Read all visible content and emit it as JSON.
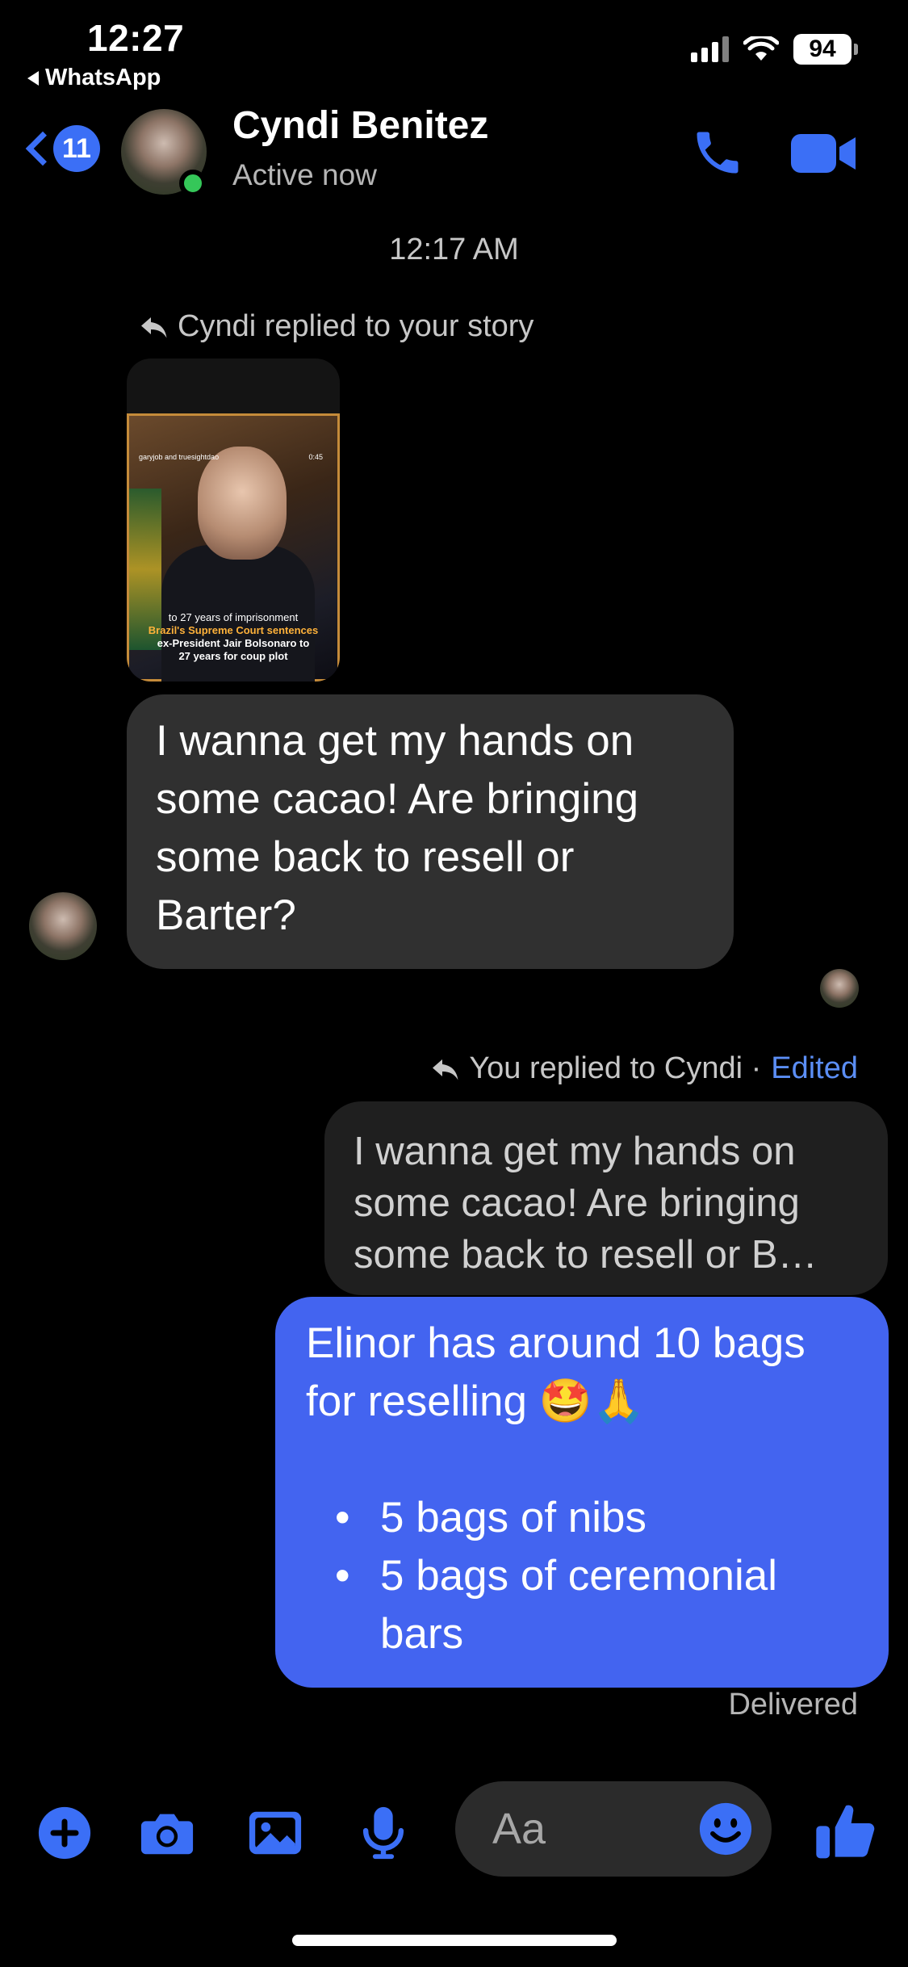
{
  "status_bar": {
    "time": "12:27",
    "back_app": "WhatsApp",
    "battery": "94"
  },
  "header": {
    "unread_count": "11",
    "contact_name": "Cyndi Benitez",
    "contact_status": "Active now"
  },
  "conversation": {
    "timestamp": "12:17 AM",
    "story_reply_label": "Cyndi replied to your story",
    "story_preview": {
      "top_left": "garyjob and truesightdao",
      "top_right": "0:45",
      "caption_1": "to 27 years of imprisonment",
      "caption_2": "Brazil's Supreme Court sentences",
      "caption_3": "ex-President Jair Bolsonaro to",
      "caption_4": "27 years for coup plot"
    },
    "incoming_message": "I wanna get my hands on some cacao! Are bringing some back to resell or Barter?",
    "my_reply_label": "You replied to Cyndi ·",
    "edited_label": "Edited",
    "quoted_message": "I wanna get my hands on some cacao! Are bringing some back to resell or B…",
    "outgoing_message": {
      "intro": "Elinor has around 10 bags for reselling 🤩🙏",
      "items": [
        "5 bags of nibs",
        "5 bags of ceremonial bars"
      ]
    },
    "delivery_status": "Delivered"
  },
  "composer": {
    "placeholder": "Aa"
  },
  "colors": {
    "accent": "#3b6ff6",
    "outgoing_bubble": "#4364f0",
    "incoming_bubble": "#303030",
    "online": "#35c759"
  }
}
